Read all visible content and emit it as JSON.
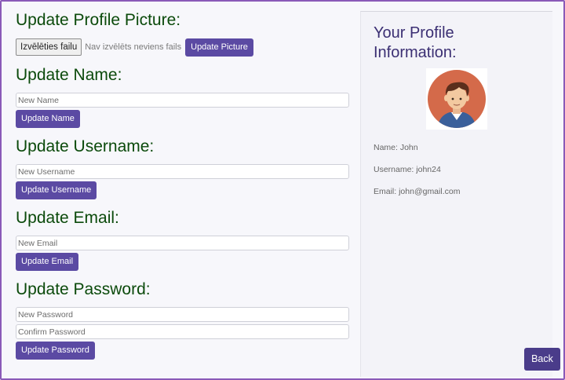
{
  "sections": {
    "picture": {
      "title": "Update Profile Picture:",
      "file_button": "Izvēlēties failu",
      "file_status": "Nav izvēlēts neviens fails",
      "submit": "Update Picture"
    },
    "name": {
      "title": "Update Name:",
      "placeholder": "New Name",
      "submit": "Update Name"
    },
    "username": {
      "title": "Update Username:",
      "placeholder": "New Username",
      "submit": "Update Username"
    },
    "email": {
      "title": "Update Email:",
      "placeholder": "New Email",
      "submit": "Update Email"
    },
    "password": {
      "title": "Update Password:",
      "placeholder_new": "New Password",
      "placeholder_confirm": "Confirm Password",
      "submit": "Update Password"
    }
  },
  "profile": {
    "title": "Your Profile Information:",
    "name_line": "Name: John",
    "username_line": "Username: john24",
    "email_line": "Email: john@gmail.com",
    "avatar_icon": "user-avatar-icon"
  },
  "back_button": "Back",
  "colors": {
    "heading_green": "#0b4a0b",
    "button_purple": "#5b4aa3",
    "profile_title": "#3b2f73",
    "frame_border": "#8a5ab8"
  }
}
